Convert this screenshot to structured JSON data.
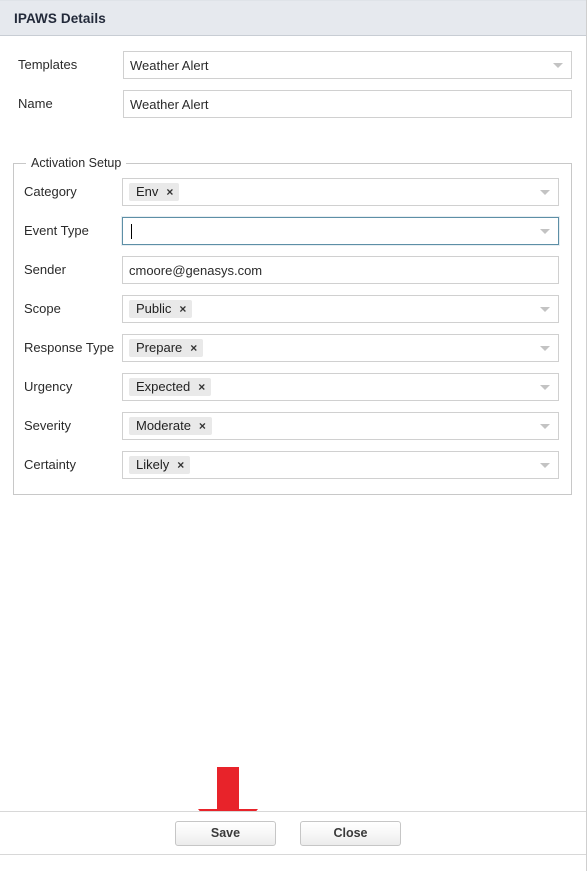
{
  "window": {
    "title": "IPAWS Details"
  },
  "form": {
    "templates": {
      "label": "Templates",
      "value": "Weather Alert",
      "caret_icon": "chevron-down-icon"
    },
    "name": {
      "label": "Name",
      "value": "Weather Alert"
    }
  },
  "activation_setup": {
    "legend": "Activation Setup",
    "fields": [
      {
        "label": "Category",
        "type": "multiselect",
        "chips": [
          {
            "label": "Env",
            "remove_icon": "×"
          }
        ],
        "value": "",
        "focused": false
      },
      {
        "label": "Event Type",
        "type": "multiselect",
        "chips": [],
        "value": "",
        "focused": true
      },
      {
        "label": "Sender",
        "type": "text",
        "chips": [],
        "value": "cmoore@genasys.com",
        "focused": false
      },
      {
        "label": "Scope",
        "type": "multiselect",
        "chips": [
          {
            "label": "Public",
            "remove_icon": "×"
          }
        ],
        "value": "",
        "focused": false
      },
      {
        "label": "Response Type",
        "type": "multiselect",
        "chips": [
          {
            "label": "Prepare",
            "remove_icon": "×"
          }
        ],
        "value": "",
        "focused": false
      },
      {
        "label": "Urgency",
        "type": "multiselect",
        "chips": [
          {
            "label": "Expected",
            "remove_icon": "×"
          }
        ],
        "value": "",
        "focused": false
      },
      {
        "label": "Severity",
        "type": "multiselect",
        "chips": [
          {
            "label": "Moderate",
            "remove_icon": "×"
          }
        ],
        "value": "",
        "focused": false
      },
      {
        "label": "Certainty",
        "type": "multiselect",
        "chips": [
          {
            "label": "Likely",
            "remove_icon": "×"
          }
        ],
        "value": "",
        "focused": false
      }
    ]
  },
  "annotation": {
    "arrow_icon": "arrow-down-icon",
    "color": "#E8232A",
    "points_to": "Save"
  },
  "footer": {
    "save_label": "Save",
    "close_label": "Close"
  },
  "colors": {
    "titlebar_bg": "#E6E9EE",
    "title_text": "#232A3A",
    "field_border": "#D0D0D0",
    "focus_border": "#5D8FA6",
    "chip_bg": "#E9E9E9",
    "annotation_red": "#E8232A"
  }
}
